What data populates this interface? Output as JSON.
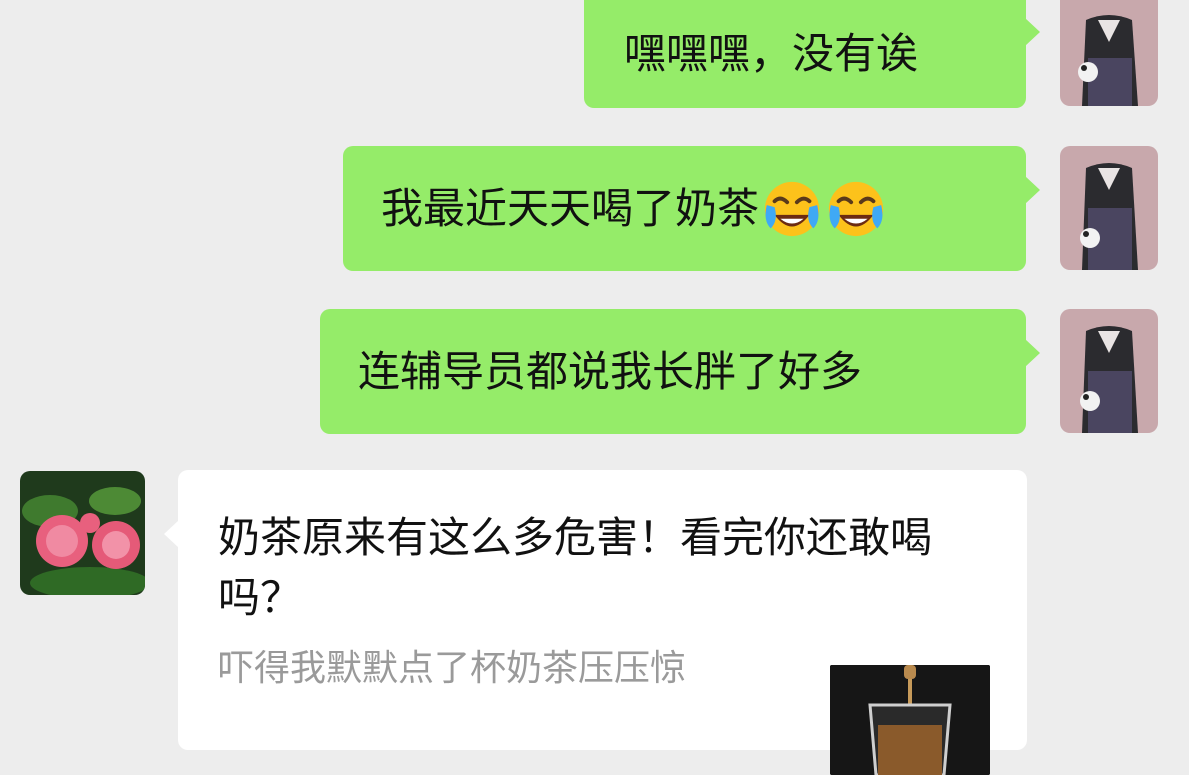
{
  "messages": [
    {
      "sender": "me",
      "text": "嘿嘿嘿，没有诶"
    },
    {
      "sender": "me",
      "text": "我最近天天喝了奶茶",
      "emojis": [
        "face-with-tears-of-joy-icon",
        "face-with-tears-of-joy-icon"
      ]
    },
    {
      "sender": "me",
      "text": "连辅导员都说我长胖了好多"
    },
    {
      "sender": "friend",
      "type": "link-card",
      "title": "奶茶原来有这么多危害！看完你还敢喝吗？",
      "desc": "吓得我默默点了杯奶茶压压惊"
    }
  ],
  "colors": {
    "outgoing_bubble": "#95ec69",
    "incoming_bubble": "#ffffff",
    "background": "#ededed",
    "desc_text": "#9a9a9a"
  }
}
